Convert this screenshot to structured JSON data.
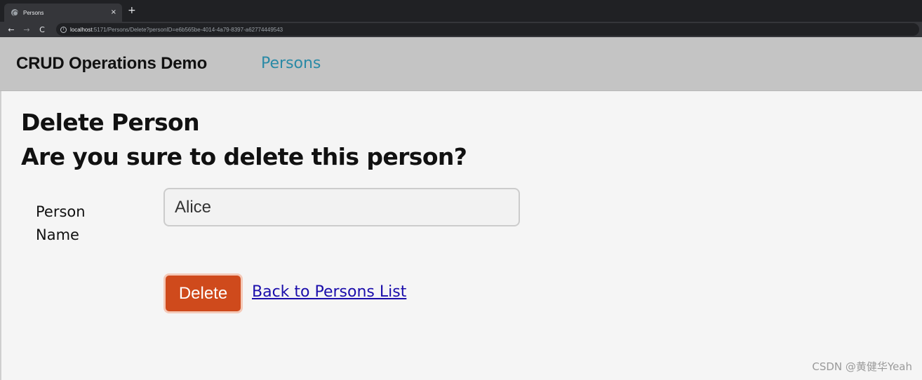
{
  "browser": {
    "tab_title": "Persons",
    "tab_close": "×",
    "new_tab": "+",
    "back": "←",
    "forward": "→",
    "reload": "C",
    "url_host": "localhost",
    "url_path": ":5171/Persons/Delete?personID=e6b565be-4014-4a79-8397-a62774449543"
  },
  "navbar": {
    "brand": "CRUD Operations Demo",
    "link": "Persons"
  },
  "page": {
    "title": "Delete Person",
    "question": "Are you sure to delete this person?",
    "field_label": "Person Name",
    "field_value": "Alice",
    "delete_label": "Delete",
    "back_label": "Back to Persons List"
  },
  "watermark": "CSDN @黄健华Yeah",
  "colors": {
    "navbar_bg": "#c4c4c4",
    "nav_link": "#2a8aa6",
    "delete_button": "#cf4a1c",
    "link": "#1a0dab"
  }
}
